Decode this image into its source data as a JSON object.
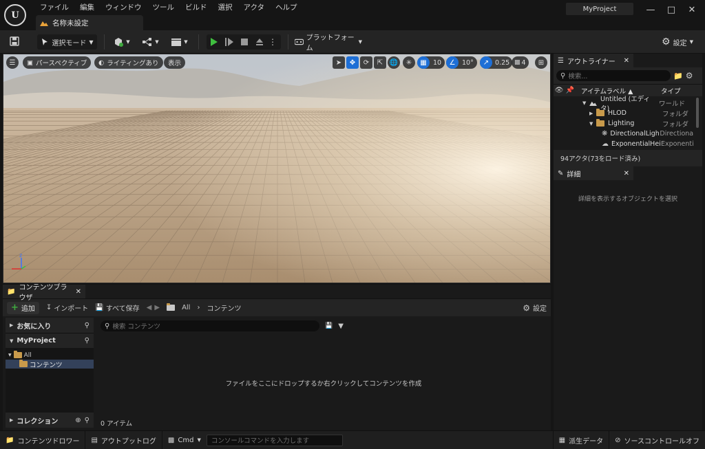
{
  "menu": [
    "ファイル",
    "編集",
    "ウィンドウ",
    "ツール",
    "ビルド",
    "選択",
    "アクタ",
    "ヘルプ"
  ],
  "project_name": "MyProject",
  "document_tab": "名称未設定",
  "toolbar": {
    "select_mode": "選択モード",
    "platforms": "プラットフォーム",
    "settings": "設定"
  },
  "viewport": {
    "perspective": "パースペクティブ",
    "lighting": "ライティングあり",
    "show": "表示",
    "grid_snap": "10",
    "rotation_snap": "10°",
    "scale_snap": "0.25",
    "camera_speed": "4"
  },
  "outliner": {
    "tab_label": "アウトライナー",
    "search_placeholder": "検索...",
    "col_label": "アイテムラベル",
    "col_type": "タイプ",
    "rows": [
      {
        "label": "Untitled (エディタ)",
        "type": "ワールド"
      },
      {
        "label": "HLOD",
        "type": "フォルダ"
      },
      {
        "label": "Lighting",
        "type": "フォルダ"
      },
      {
        "label": "DirectionalLight",
        "type": "Directiona"
      },
      {
        "label": "ExponentialHeig",
        "type": "Exponenti"
      }
    ],
    "status": "94アクタ(73をロード済み)"
  },
  "details": {
    "tab_label": "詳細",
    "empty_message": "詳細を表示するオブジェクトを選択"
  },
  "content_browser": {
    "tab_label": "コンテンツブラウザ",
    "add": "追加",
    "import": "インポート",
    "save_all": "すべて保存",
    "path_root": "All",
    "path_current": "コンテンツ",
    "settings": "設定",
    "favorites": "お気に入り",
    "project": "MyProject",
    "tree_all": "All",
    "tree_content": "コンテンツ",
    "collections": "コレクション",
    "search_placeholder": "検索 コンテンツ",
    "empty_message": "ファイルをここにドロップするか右クリックしてコンテンツを作成",
    "item_count": "0 アイテム"
  },
  "statusbar": {
    "content_drawer": "コンテンツドロワー",
    "output_log": "アウトプットログ",
    "cmd": "Cmd",
    "console_placeholder": "コンソールコマンドを入力します",
    "derived_data": "派生データ",
    "source_control": "ソースコントロールオフ"
  },
  "colors": {
    "accent_blue": "#1e6fd6",
    "play_green": "#3fbf3f",
    "add_green": "#3faa3f",
    "folder": "#c89a4b"
  }
}
